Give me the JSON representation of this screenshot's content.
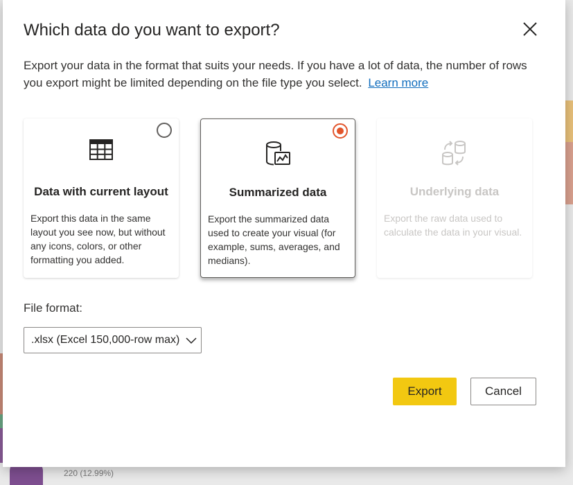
{
  "dialog": {
    "title": "Which data do you want to export?",
    "description": "Export your data in the format that suits your needs. If you have a lot of data, the number of rows you export might be limited depending on the file type you select.",
    "learn_more": "Learn more"
  },
  "options": [
    {
      "title": "Data with current layout",
      "description": "Export this data in the same layout you see now, but without any icons, colors, or other formatting you added.",
      "icon": "table-icon",
      "selected": false,
      "disabled": false
    },
    {
      "title": "Summarized data",
      "description": "Export the summarized data used to create your visual (for example, sums, averages, and medians).",
      "icon": "summarized-data-icon",
      "selected": true,
      "disabled": false
    },
    {
      "title": "Underlying data",
      "description": "Export the raw data used to calculate the data in your visual.",
      "icon": "underlying-data-icon",
      "selected": false,
      "disabled": true
    }
  ],
  "file_format": {
    "label": "File format:",
    "selected": ".xlsx (Excel 150,000-row max)"
  },
  "buttons": {
    "export": "Export",
    "cancel": "Cancel"
  },
  "background": {
    "partial_label": "220 (12.99%)"
  },
  "colors": {
    "accent_radio": "#e2542a",
    "export_button": "#f2c811",
    "link": "#0f6cbd"
  }
}
